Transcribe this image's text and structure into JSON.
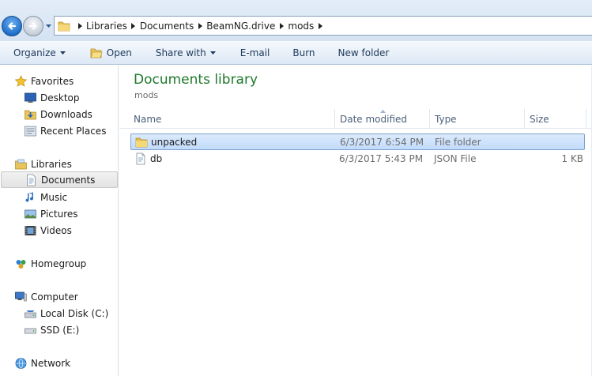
{
  "window": {
    "title": "Documents library"
  },
  "nav_buttons": {
    "back_icon": "back-arrow-icon",
    "forward_icon": "forward-arrow-icon"
  },
  "address": {
    "crumbs": [
      "Libraries",
      "Documents",
      "BeamNG.drive",
      "mods"
    ]
  },
  "toolbar": {
    "organize": "Organize",
    "open": "Open",
    "share_with": "Share with",
    "email": "E-mail",
    "burn": "Burn",
    "new_folder": "New folder"
  },
  "sidebar": {
    "favorites": {
      "label": "Favorites",
      "items": [
        {
          "label": "Desktop",
          "icon": "desktop-icon"
        },
        {
          "label": "Downloads",
          "icon": "downloads-icon"
        },
        {
          "label": "Recent Places",
          "icon": "recent-places-icon"
        }
      ]
    },
    "libraries": {
      "label": "Libraries",
      "items": [
        {
          "label": "Documents",
          "icon": "documents-icon",
          "selected": true
        },
        {
          "label": "Music",
          "icon": "music-icon"
        },
        {
          "label": "Pictures",
          "icon": "pictures-icon"
        },
        {
          "label": "Videos",
          "icon": "videos-icon"
        }
      ]
    },
    "homegroup": {
      "label": "Homegroup"
    },
    "computer": {
      "label": "Computer",
      "items": [
        {
          "label": "Local Disk (C:)",
          "icon": "local-disk-icon"
        },
        {
          "label": "SSD (E:)",
          "icon": "drive-icon"
        }
      ]
    },
    "network": {
      "label": "Network"
    }
  },
  "main": {
    "heading": "Documents library",
    "subheading": "mods",
    "columns": {
      "name": "Name",
      "date": "Date modified",
      "type": "Type",
      "size": "Size"
    },
    "rows": [
      {
        "name": "unpacked",
        "date": "6/3/2017 6:54 PM",
        "type": "File folder",
        "size": "",
        "icon": "folder-icon",
        "selected": true
      },
      {
        "name": "db",
        "date": "6/3/2017 5:43 PM",
        "type": "JSON File",
        "size": "1 KB",
        "icon": "file-icon",
        "selected": false
      }
    ]
  },
  "colors": {
    "heading_green": "#1e7a2c",
    "toolbar_text": "#1e395b",
    "selection_fill": "#c9e0fc",
    "selection_border": "#7da2ce"
  }
}
